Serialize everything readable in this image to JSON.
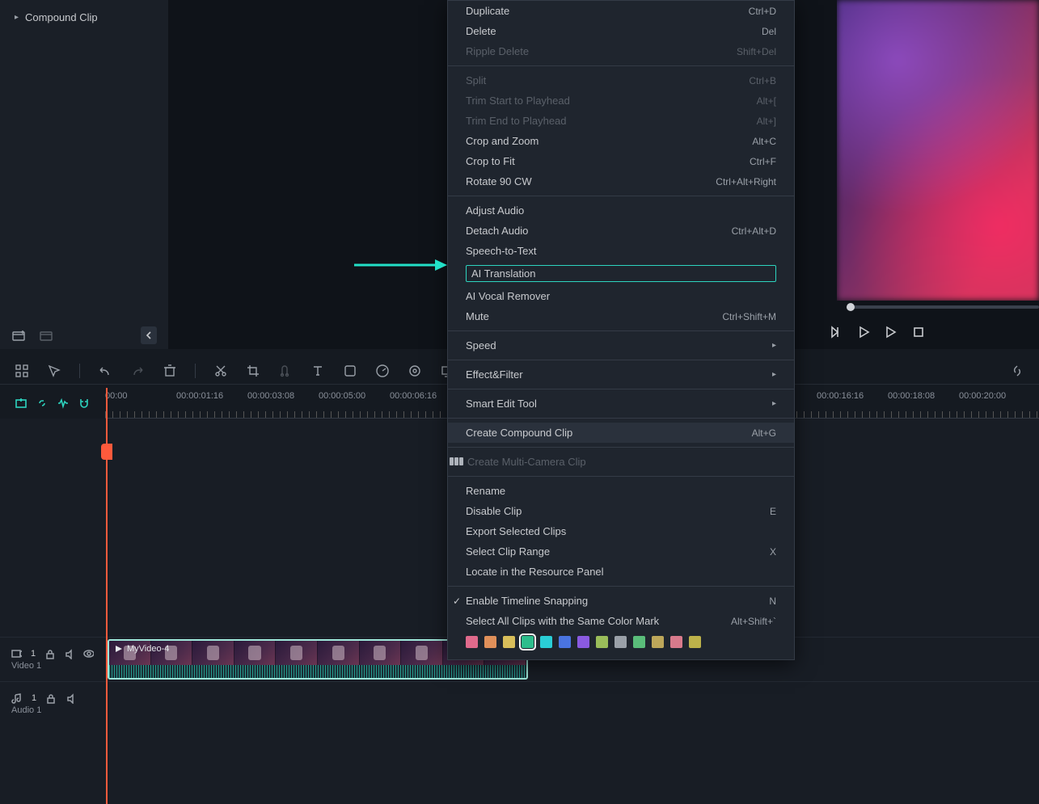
{
  "sidebar": {
    "compound_clip": "Compound Clip"
  },
  "context_menu": {
    "sections": [
      [
        {
          "label": "Duplicate",
          "shortcut": "Ctrl+D"
        },
        {
          "label": "Delete",
          "shortcut": "Del"
        },
        {
          "label": "Ripple Delete",
          "shortcut": "Shift+Del",
          "disabled": true
        }
      ],
      [
        {
          "label": "Split",
          "shortcut": "Ctrl+B",
          "disabled": true
        },
        {
          "label": "Trim Start to Playhead",
          "shortcut": "Alt+[",
          "disabled": true
        },
        {
          "label": "Trim End to Playhead",
          "shortcut": "Alt+]",
          "disabled": true
        },
        {
          "label": "Crop and Zoom",
          "shortcut": "Alt+C"
        },
        {
          "label": "Crop to Fit",
          "shortcut": "Ctrl+F"
        },
        {
          "label": "Rotate 90 CW",
          "shortcut": "Ctrl+Alt+Right"
        }
      ],
      [
        {
          "label": "Adjust Audio"
        },
        {
          "label": "Detach Audio",
          "shortcut": "Ctrl+Alt+D"
        },
        {
          "label": "Speech-to-Text"
        },
        {
          "label": "AI Translation",
          "highlight": true
        },
        {
          "label": "AI Vocal Remover"
        },
        {
          "label": "Mute",
          "shortcut": "Ctrl+Shift+M"
        }
      ],
      [
        {
          "label": "Speed",
          "submenu": true
        }
      ],
      [
        {
          "label": "Effect&Filter",
          "submenu": true
        }
      ],
      [
        {
          "label": "Smart Edit Tool",
          "submenu": true
        }
      ],
      [
        {
          "label": "Create Compound Clip",
          "shortcut": "Alt+G",
          "hovered": true
        }
      ],
      [
        {
          "label": "Create Multi-Camera Clip",
          "disabled": true,
          "mc_icon": true
        }
      ],
      [
        {
          "label": "Rename"
        },
        {
          "label": "Disable Clip",
          "shortcut": "E"
        },
        {
          "label": "Export Selected Clips"
        },
        {
          "label": "Select Clip Range",
          "shortcut": "X"
        },
        {
          "label": "Locate in the Resource Panel"
        }
      ],
      [
        {
          "label": "Enable Timeline Snapping",
          "shortcut": "N",
          "checked": true
        },
        {
          "label": "Select All Clips with the Same Color Mark",
          "shortcut": "Alt+Shift+`"
        }
      ]
    ],
    "colors": [
      "#e06a8c",
      "#e0905a",
      "#d8be5a",
      "#2dbd8c",
      "#2aced6",
      "#4a74e0",
      "#8a5ae0",
      "#9abd5a",
      "#9aa0a8",
      "#5abd7a",
      "#bda75a",
      "#d87a8c",
      "#bdb24a"
    ],
    "selected_color_index": 3
  },
  "timeline": {
    "ticks": [
      {
        "pos": 0,
        "label": "00:00"
      },
      {
        "pos": 88,
        "label": "00:00:01:16"
      },
      {
        "pos": 176,
        "label": "00:00:03:08"
      },
      {
        "pos": 264,
        "label": "00:00:05:00"
      },
      {
        "pos": 352,
        "label": "00:00:06:16"
      },
      {
        "pos": 880,
        "label": "00:00:16:16"
      },
      {
        "pos": 968,
        "label": "00:00:18:08"
      },
      {
        "pos": 1056,
        "label": "00:00:20:00"
      }
    ]
  },
  "tracks": {
    "video": {
      "name": "Video 1",
      "count": "1"
    },
    "audio": {
      "name": "Audio 1",
      "count": "1"
    }
  },
  "clip": {
    "title": "MyVideo-4"
  }
}
